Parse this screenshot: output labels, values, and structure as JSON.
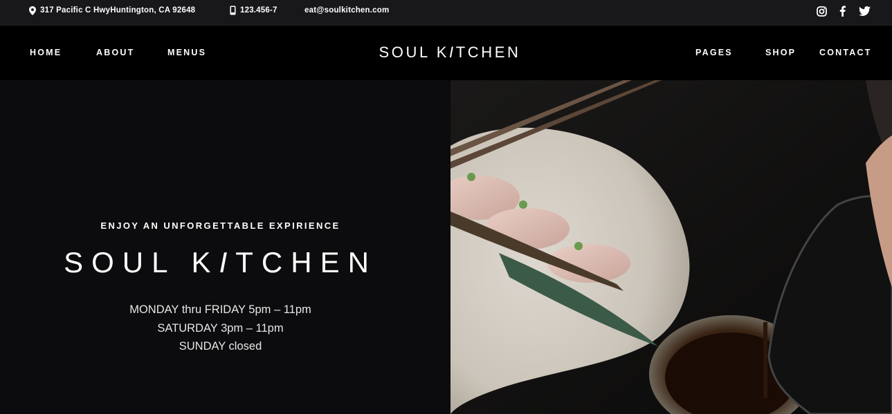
{
  "topbar": {
    "address": "317 Pacific C HwyHuntington, CA 92648",
    "phone": "123.456-7",
    "email": "eat@soulkitchen.com",
    "social": [
      "instagram-icon",
      "facebook-icon",
      "twitter-icon"
    ]
  },
  "nav": {
    "left": [
      "HOME",
      "ABOUT",
      "MENUS"
    ],
    "right": [
      "PAGES",
      "SHOP",
      "CONTACT"
    ],
    "logo_part1": "SOUL K",
    "logo_i": "I",
    "logo_part2": "TCHEN"
  },
  "hero": {
    "eyebrow": "ENJOY AN UNFORGETTABLE EXPIRIENCE",
    "title_part1": "SOUL K",
    "title_i": "I",
    "title_part2": "TCHEN",
    "hours": [
      "MONDAY thru FRIDAY 5pm – 11pm",
      "SATURDAY 3pm – 11pm",
      "SUNDAY closed"
    ]
  },
  "colors": {
    "background": "#0c0b0d",
    "topbar": "#18171a",
    "nav": "#000000",
    "text": "#ffffff"
  }
}
